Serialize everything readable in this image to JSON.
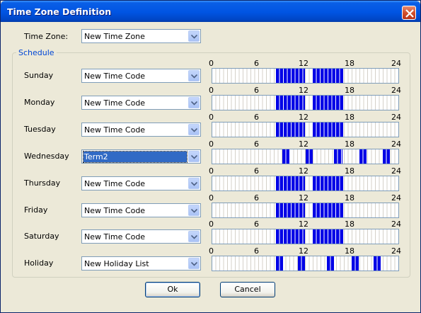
{
  "window": {
    "title": "Time Zone Definition"
  },
  "time_zone": {
    "label": "Time Zone:",
    "value": "New Time Zone"
  },
  "schedule": {
    "group_label": "Schedule",
    "tick_labels": [
      "0",
      "6",
      "12",
      "18",
      "24"
    ],
    "days": [
      {
        "label": "Sunday",
        "value": "New Time Code",
        "selected": false
      },
      {
        "label": "Monday",
        "value": "New Time Code",
        "selected": false
      },
      {
        "label": "Tuesday",
        "value": "New Time Code",
        "selected": false
      },
      {
        "label": "Wednesday",
        "value": "Term2",
        "selected": true
      },
      {
        "label": "Thursday",
        "value": "New Time Code",
        "selected": false
      },
      {
        "label": "Friday",
        "value": "New Time Code",
        "selected": false
      },
      {
        "label": "Saturday",
        "value": "New Time Code",
        "selected": false
      },
      {
        "label": "Holiday",
        "value": "New Holiday List",
        "selected": false
      }
    ]
  },
  "buttons": {
    "ok": "Ok",
    "cancel": "Cancel"
  },
  "colors": {
    "active_block": "#0000e6",
    "title_bar": "#0054e3",
    "group_label": "#0046d5"
  }
}
